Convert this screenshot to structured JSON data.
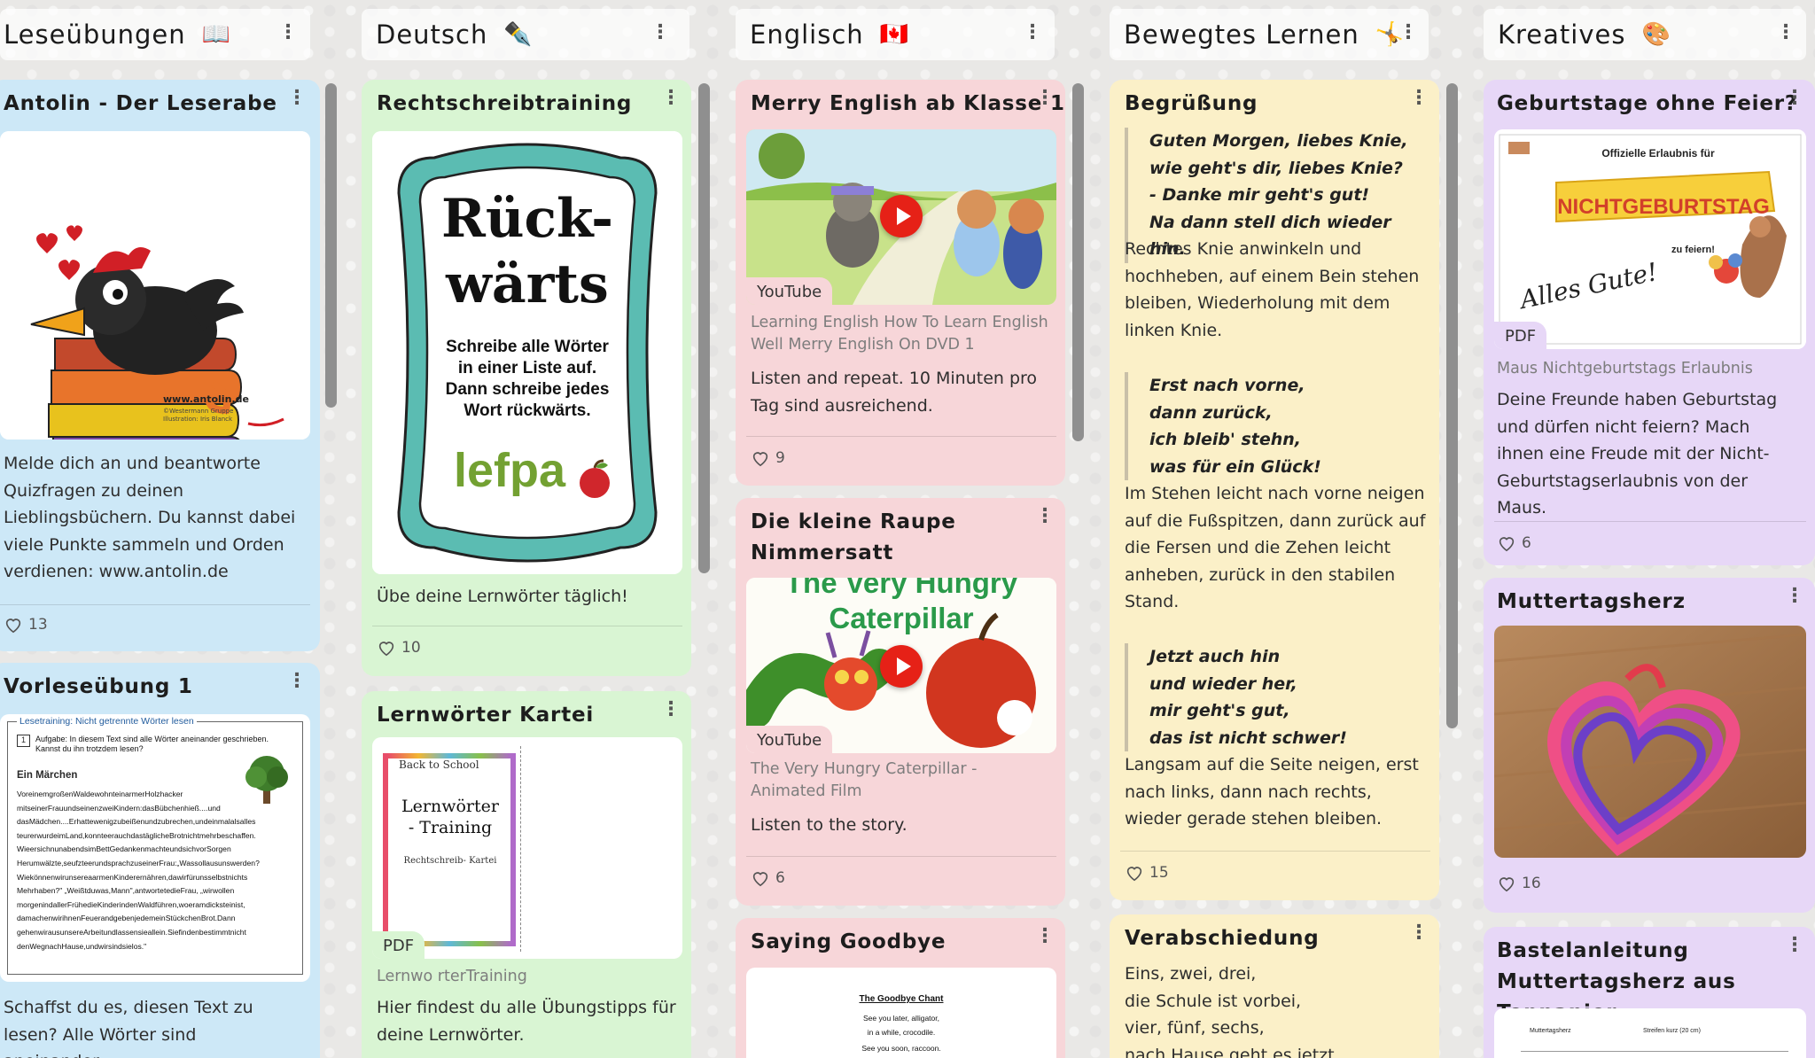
{
  "columns": [
    {
      "title": "Leseübungen",
      "emoji": "📖",
      "cards": [
        {
          "title": "Antolin - Der Leserabe",
          "image_caption": "www.antolin.de",
          "image_credit": "©Westermann Gruppe Illustration: Iris Blanck",
          "body": "Melde dich an und beantworte Quizfragen zu deinen Lieblingsbüchern. Du kannst dabei viele Punkte sammeln und Orden verdienen: www.antolin.de",
          "likes": "13"
        },
        {
          "title": "Vorleseübung 1",
          "doc_header": "Lesetraining: Nicht getrennte Wörter lesen",
          "doc_task": "Aufgabe: In diesem Text sind alle Wörter aneinander geschrieben. Kannst du ihn trotzdem lesen?",
          "doc_heading": "Ein Märchen",
          "doc_lines": [
            "VoreinemgroßenWaldewohnteinarmerHolzhacker",
            "mitseinerFrauundseinenzweiKindern:dasBübchenhieß....und",
            "dasMädchen....Erhattewenigzubeißenundzubrechen,undeinmalalsalles",
            "teurerwurdeimLand,konnteerauchdastäglicheBrotnichtmehrbeschaffen.",
            "WieersichnunabendsimBettGedankenmachteundsichvorSorgen",
            "Herumwälzte,seufzteerundsprachzuseinerFrau:„Wassollausunswerden?",
            "WiekönnenwirunsereaarmenKinderernähren,dawirfürunsselbstnichts",
            "Mehrhaben?\" „Weißtduwas,Mann\",antwortetedieFrau, „wirwollen",
            "morgenindallerFrühedieKinderindenWaldführen,woeramdicksteinist,",
            "damachenwirihnenFeuerandgebenjedemeinStückchenBrot.Dann",
            "gehenwirausunsereArbeitundlassensieallein.Siefindenbestimmtnicht",
            "denWegnachHause,undwirsindsielos.\""
          ],
          "body": "Schaffst du es, diesen Text zu lesen? Alle Wörter sind aneinander"
        }
      ]
    },
    {
      "title": "Deutsch",
      "emoji": "✒️",
      "cards": [
        {
          "title": "Rechtschreibtraining",
          "poster_title_1": "Rück-",
          "poster_title_2": "wärts",
          "poster_text": "Schreibe alle Wörter in einer Liste auf. Dann schreibe jedes Wort rückwärts.",
          "poster_brand": "lefpa",
          "body": "Übe deine Lernwörter täglich!",
          "likes": "10"
        },
        {
          "title": "Lernwörter Kartei",
          "doc_top": "Back to School",
          "doc_title": "Lernwörter - Training",
          "doc_sub": "Rechtschreib- Kartei",
          "badge": "PDF",
          "meta": "Lernwo rterTraining",
          "body": "Hier findest du alle Übungstipps für deine Lernwörter."
        }
      ]
    },
    {
      "title": "Englisch",
      "emoji": "🇨🇦",
      "cards": [
        {
          "title": "Merry English ab Klasse 1",
          "badge": "YouTube",
          "meta": "Learning English  How To Learn English Well  Merry English On DVD 1",
          "body": "Listen and repeat. 10 Minuten pro Tag sind ausreichend.",
          "likes": "9"
        },
        {
          "title": "Die kleine Raupe Nimmersatt",
          "video_title": "The Very Hungry Caterpillar",
          "badge": "YouTube",
          "meta": "The Very Hungry Caterpillar - Animated Film",
          "body": "Listen to the story.",
          "likes": "6"
        },
        {
          "title": "Saying Goodbye",
          "doc_title": "The Goodbye Chant",
          "doc_lines": [
            "See you later, alligator,",
            "in a while, crocodile.",
            "See you soon, raccoon."
          ]
        }
      ]
    },
    {
      "title": "Bewegtes Lernen",
      "emoji": "🤸",
      "cards": [
        {
          "title": "Begrüßung",
          "quote1": [
            "Guten Morgen, liebes Knie,",
            "wie geht's dir, liebes Knie?",
            "- Danke mir geht's gut!",
            "Na dann stell dich wieder hin."
          ],
          "text1": "Rechtes Knie anwinkeln und hochheben, auf einem Bein stehen bleiben, Wiederholung mit dem linken Knie.",
          "quote2": [
            "Erst nach vorne,",
            "dann zurück,",
            "ich bleib' stehn,",
            "was für ein Glück!"
          ],
          "text2": "Im Stehen leicht nach vorne neigen auf die Fußspitzen, dann zurück auf die Fersen und die Zehen leicht anheben, zurück in den stabilen Stand.",
          "quote3": [
            "Jetzt auch hin",
            "und wieder her,",
            "mir geht's gut,",
            "das ist nicht schwer!"
          ],
          "text3": "Langsam auf die Seite neigen, erst nach links, dann nach rechts, wieder gerade stehen bleiben.",
          "likes": "15"
        },
        {
          "title": "Verabschiedung",
          "lines": [
            "Eins, zwei, drei,",
            "die Schule ist vorbei,",
            "vier, fünf, sechs,",
            "nach Hause geht es jetzt."
          ]
        }
      ]
    },
    {
      "title": "Kreatives",
      "emoji": "🎨",
      "cards": [
        {
          "title": "Geburtstage ohne Feier?",
          "poster_top": "Offizielle Erlaubnis für",
          "poster_banner": "NICHTGEBURTSTAG",
          "poster_sub": "zu feiern!",
          "poster_hand": "Alles Gute!",
          "badge": "PDF",
          "meta": "Maus Nichtgeburtstags Erlaubnis",
          "body": "Deine Freunde haben Geburtstag und dürfen nicht feiern? Mach ihnen eine Freude mit der Nicht-Geburtstagserlaubnis von der Maus.",
          "likes": "6"
        },
        {
          "title": "Muttertagsherz",
          "likes": "16"
        },
        {
          "title": "Bastelanleitung Muttertagsherz aus Tonpapier",
          "doc_left": "Muttertagsherz",
          "doc_right": "Streifen kurz (20 cm)"
        }
      ]
    }
  ],
  "colors": {
    "blue": "#cde8f7",
    "green": "#d9f5d3",
    "pink": "#f7d6d9",
    "yellow": "#fbf0c8",
    "violet": "#e7d7f7",
    "youtube_red": "#e62117"
  }
}
